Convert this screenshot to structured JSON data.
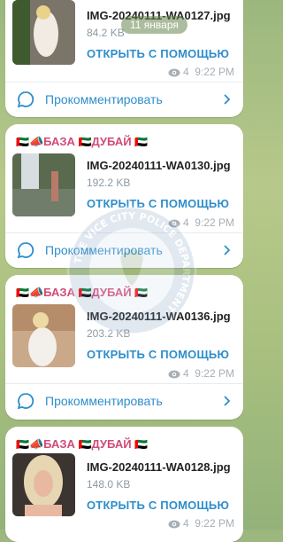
{
  "date_separator": "11 января",
  "header_line": {
    "base": "БАЗА",
    "city": "ДУБАЙ"
  },
  "open_with_label": "ОТКРЫТЬ С ПОМОЩЬЮ",
  "comment_label": "Прокомментировать",
  "watermark_text": "THE VICE CITY POLICE DEPARTMENT",
  "posts": [
    {
      "file_name": "IMG-20240111-WA0127.jpg",
      "size": "84.2 KB",
      "views": "4",
      "time": "9:22 PM"
    },
    {
      "file_name": "IMG-20240111-WA0130.jpg",
      "size": "192.2 KB",
      "views": "4",
      "time": "9:22 PM"
    },
    {
      "file_name": "IMG-20240111-WA0136.jpg",
      "size": "203.2 KB",
      "views": "4",
      "time": "9:22 PM"
    },
    {
      "file_name": "IMG-20240111-WA0128.jpg",
      "size": "148.0 KB",
      "views": "4",
      "time": "9:22 PM"
    }
  ],
  "colors": {
    "link": "#2e8ecb",
    "brand_pink": "#d14a77",
    "muted": "#a7afb5",
    "bg_green": "#a9c07f"
  }
}
